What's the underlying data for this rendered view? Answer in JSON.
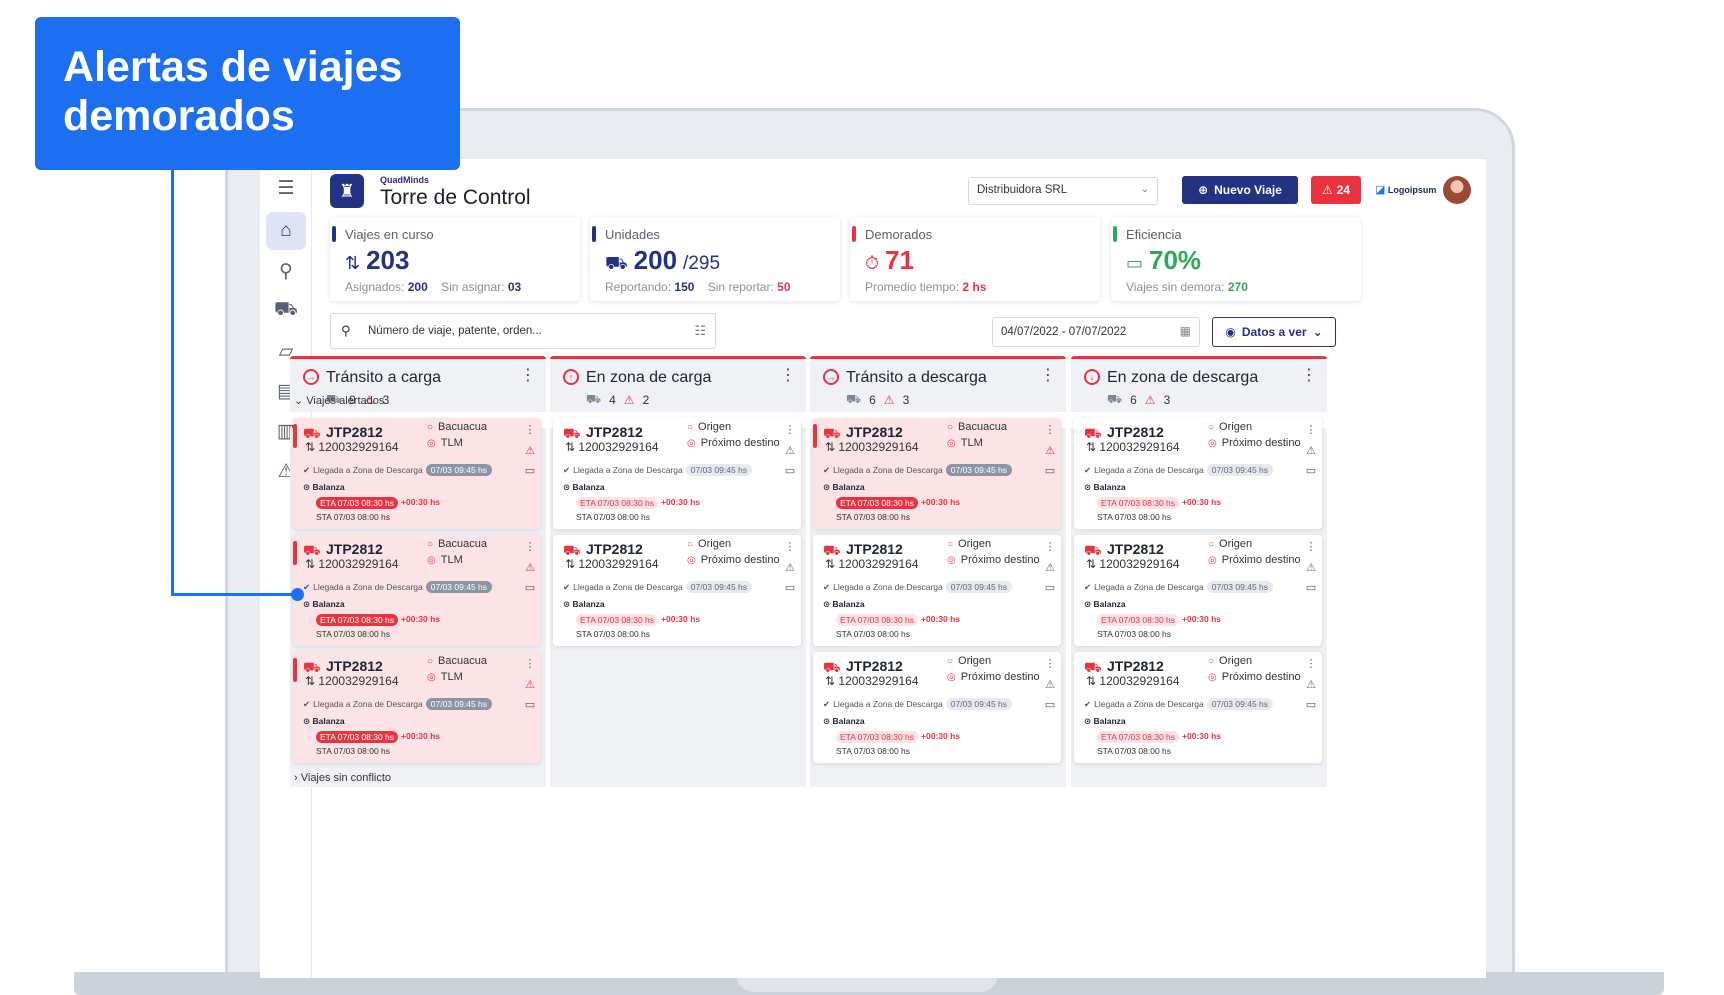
{
  "callout": {
    "line1": "Alertas de viajes",
    "line2": "demorados"
  },
  "brand": {
    "small": "QuadMinds",
    "title": "Torre de Control"
  },
  "header": {
    "distributor": "Distribuidora SRL",
    "new_trip": "Nuevo Viaje",
    "alert_count": "24",
    "logo_text": "Logoipsum"
  },
  "stats": [
    {
      "label": "Viajes en curso",
      "value": "203",
      "sub": "",
      "foot1_label": "Asignados:",
      "foot1_value": "200",
      "foot2_label": "Sin asignar:",
      "foot2_value": "03",
      "color": "#243284",
      "icon": "route-icon"
    },
    {
      "label": "Unidades",
      "value": "200",
      "sub": "/295",
      "foot1_label": "Reportando:",
      "foot1_value": "150",
      "foot2_label": "Sin reportar:",
      "foot2_value": "50",
      "color": "#243284",
      "icon": "truck-icon"
    },
    {
      "label": "Demorados",
      "value": "71",
      "sub": "",
      "foot1_label": "Promedio tiempo:",
      "foot1_value": "2 hs",
      "foot2_label": "",
      "foot2_value": "",
      "color": "#ea3340",
      "icon": "stopwatch-icon"
    },
    {
      "label": "Eficiencia",
      "value": "70%",
      "sub": "",
      "foot1_label": "Viajes sin demora:",
      "foot1_value": "270",
      "foot2_label": "",
      "foot2_value": "",
      "color": "#2fa85a",
      "icon": "archive-icon"
    }
  ],
  "search": {
    "placeholder": "Número de viaje, patente, orden..."
  },
  "date_range": "04/07/2022 - 07/07/2022",
  "datos_button": "Datos a ver",
  "columns": [
    {
      "title": "Tránsito a carga",
      "trucks": "9",
      "alerts": "3"
    },
    {
      "title": "En zona de carga",
      "trucks": "4",
      "alerts": "2"
    },
    {
      "title": "Tránsito a descarga",
      "trucks": "6",
      "alerts": "3"
    },
    {
      "title": "En zona de descarga",
      "trucks": "6",
      "alerts": "3"
    }
  ],
  "groups": {
    "alerted": "Viajes alertados",
    "no_conflict": "Viajes sin conflicto"
  },
  "trip_templates": {
    "bacuacua": {
      "code": "JTP2812",
      "number": "120032929164",
      "loc1": "Bacuacua",
      "loc2": "TLM"
    },
    "origen": {
      "code": "JTP2812",
      "number": "120032929164",
      "loc1": "Origen",
      "loc2": "Próximo destino"
    }
  },
  "trip_common": {
    "event": "Llegada a Zona de Descarga",
    "event_time": "07/03 09:45 hs",
    "stop": "Balanza",
    "eta": "ETA 07/03 08:30 hs",
    "delay": "+00:30 hs",
    "sta": "STA 07/03 08:00 hs"
  },
  "colors": {
    "brand": "#243284",
    "alert": "#ea3340",
    "success": "#2fa85a",
    "callout": "#1b6ff0"
  }
}
